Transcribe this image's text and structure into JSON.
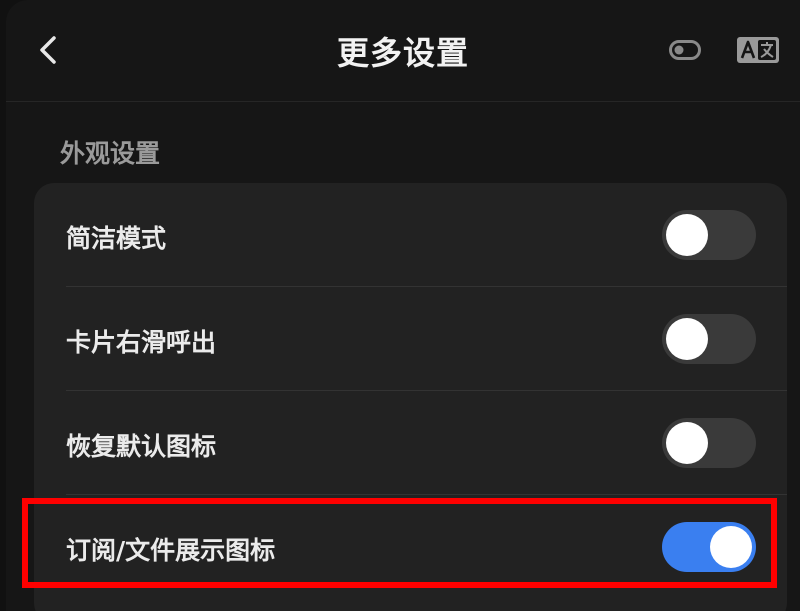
{
  "header": {
    "title": "更多设置",
    "back_icon": "chevron-left-icon",
    "toggle_icon": "toggle-icon",
    "translate_icon": "translate-icon"
  },
  "section": {
    "title": "外观设置"
  },
  "settings": [
    {
      "label": "简洁模式",
      "enabled": false
    },
    {
      "label": "卡片右滑呼出",
      "enabled": false
    },
    {
      "label": "恢复默认图标",
      "enabled": false
    },
    {
      "label": "订阅/文件展示图标",
      "enabled": true
    }
  ],
  "colors": {
    "switch_on": "#3a7ff0",
    "switch_off": "#3a3a3a",
    "highlight": "#ff0000"
  }
}
